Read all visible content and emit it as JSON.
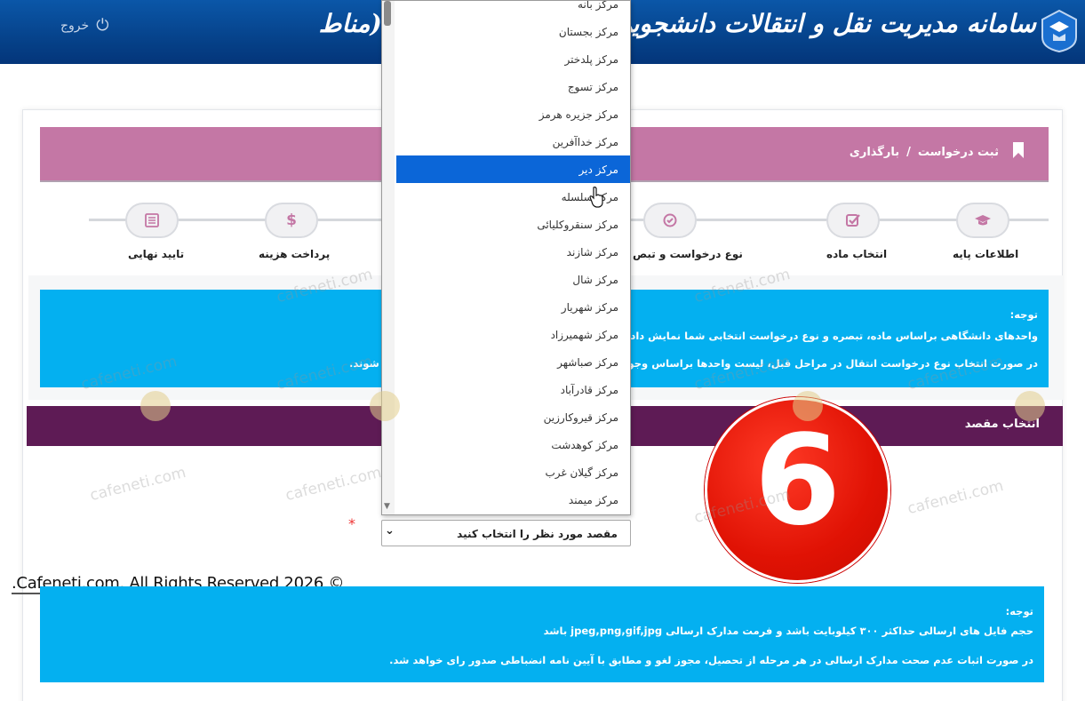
{
  "header": {
    "site_title": "سامانه مدیریت نقل و انتقالات دانشجویی دانشگاه آزاد اسلامی (مناط",
    "logout_label": "خروج",
    "logout_icon": "power-icon",
    "logo_icon": "university-logo-icon"
  },
  "breadcrumb": {
    "icon": "bookmark-icon",
    "current": "ثبت درخواست",
    "separator": "/",
    "section": "بارگذاری"
  },
  "steps": [
    {
      "label": "اطلاعات پایه",
      "icon": "graduation-cap-icon"
    },
    {
      "label": "انتخاب ماده",
      "icon": "checkbox-icon"
    },
    {
      "label": "نوع درخواست و تبص",
      "icon": "check-circle-icon"
    },
    {
      "label": "پرداخت هزینه",
      "icon": "dollar-icon",
      "glyph": "$"
    },
    {
      "label": "تایید نهایی",
      "icon": "list-icon"
    }
  ],
  "notice1": {
    "title": "توجه:",
    "line1": "واحدهای دانشگاهی براساس ماده، تبصره و نوع درخواست انتخابی شما نمایش داده می ش",
    "line2": "در صورت انتخاب نوع درخواست انتقال در مراحل قبل، لیست واحدها براساس وجود کد ر",
    "line2_end": "ل شوند."
  },
  "section": {
    "title": "انتخاب مقصد"
  },
  "destination_select": {
    "selected_label": "مقصد مورد نظر را انتخاب کنید",
    "options": [
      "مرکز بانه",
      "مرکز بجستان",
      "مرکز پلدختر",
      "مرکز تسوج",
      "مرکز جزیره هرمز",
      "مرکز خداآفرین",
      "مرکز دیر",
      "مرکز سلسله",
      "مرکز سنقروکلیائی",
      "مرکز شازند",
      "مرکز شال",
      "مرکز شهریار",
      "مرکز شهمیرزاد",
      "مرکز صباشهر",
      "مرکز قادرآباد",
      "مرکز قیروکارزین",
      "مرکز کوهدشت",
      "مرکز گیلان غرب",
      "مرکز میمند"
    ],
    "highlighted_index": 6,
    "required_mark": "*"
  },
  "notice2": {
    "title": "توجه:",
    "line1": "حجم فایل های ارسالی حداکثر ۳۰۰ کیلوبایت باشد و فرمت مدارک ارسالی jpeg,png,gif,jpg باشد",
    "line2": "در صورت اثبات عدم صحت مدارک ارسالی در هر مرحله از تحصیل، مجوز لغو و مطابق با آیین نامه انضباطی صدور رای خواهد شد."
  },
  "overlay": {
    "step_badge": "6",
    "copyright": ".Cafeneti.com. All Rights Reserved 2026 ©",
    "watermark": "cafeneti.com"
  },
  "colors": {
    "header": "#0b57a8",
    "breadcrumb_bg": "#c477a5",
    "notice_bg": "#04b0f0",
    "section_bg": "#5e1b55",
    "highlight": "#0b66d8",
    "badge_red": "#e01204"
  }
}
